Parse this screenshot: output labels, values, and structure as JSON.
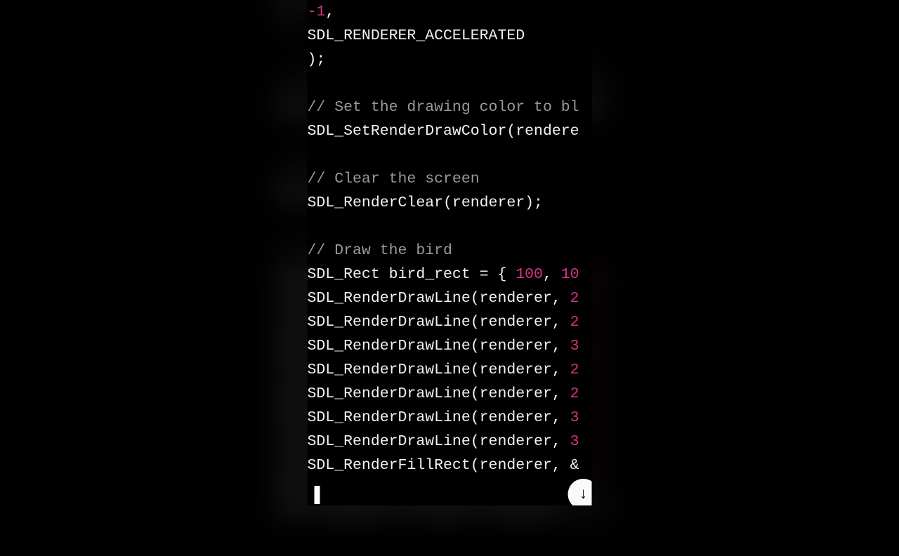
{
  "code": {
    "lines": [
      {
        "indent": "ind1",
        "tokens": [
          {
            "cls": "tok-num",
            "t": "-1"
          },
          {
            "cls": "tok-punct",
            "t": ","
          }
        ]
      },
      {
        "indent": "ind1",
        "tokens": [
          {
            "cls": "tok-ident",
            "t": "SDL_RENDERER_ACCELERATED"
          }
        ]
      },
      {
        "indent": "ind0",
        "tokens": [
          {
            "cls": "tok-punct",
            "t": ");"
          }
        ]
      },
      {
        "indent": "ind0",
        "tokens": []
      },
      {
        "indent": "ind0",
        "tokens": [
          {
            "cls": "tok-comment",
            "t": "// Set the drawing color to bl"
          }
        ]
      },
      {
        "indent": "ind0",
        "tokens": [
          {
            "cls": "tok-ident",
            "t": "SDL_SetRenderDrawColor(rendere"
          }
        ]
      },
      {
        "indent": "ind0",
        "tokens": []
      },
      {
        "indent": "ind0",
        "tokens": [
          {
            "cls": "tok-comment",
            "t": "// Clear the screen"
          }
        ]
      },
      {
        "indent": "ind0",
        "tokens": [
          {
            "cls": "tok-ident",
            "t": "SDL_RenderClear(renderer);"
          }
        ]
      },
      {
        "indent": "ind0",
        "tokens": []
      },
      {
        "indent": "ind0",
        "tokens": [
          {
            "cls": "tok-comment",
            "t": "// Draw the bird"
          }
        ]
      },
      {
        "indent": "ind0",
        "tokens": [
          {
            "cls": "tok-ident",
            "t": "SDL_Rect bird_rect = { "
          },
          {
            "cls": "tok-num",
            "t": "100"
          },
          {
            "cls": "tok-punct",
            "t": ", "
          },
          {
            "cls": "tok-num",
            "t": "10"
          }
        ]
      },
      {
        "indent": "ind0",
        "tokens": [
          {
            "cls": "tok-ident",
            "t": "SDL_RenderDrawLine(renderer, "
          },
          {
            "cls": "tok-num",
            "t": "2"
          }
        ]
      },
      {
        "indent": "ind0",
        "tokens": [
          {
            "cls": "tok-ident",
            "t": "SDL_RenderDrawLine(renderer, "
          },
          {
            "cls": "tok-num",
            "t": "2"
          }
        ]
      },
      {
        "indent": "ind0",
        "tokens": [
          {
            "cls": "tok-ident",
            "t": "SDL_RenderDrawLine(renderer, "
          },
          {
            "cls": "tok-num",
            "t": "3"
          }
        ]
      },
      {
        "indent": "ind0",
        "tokens": [
          {
            "cls": "tok-ident",
            "t": "SDL_RenderDrawLine(renderer, "
          },
          {
            "cls": "tok-num",
            "t": "2"
          }
        ]
      },
      {
        "indent": "ind0",
        "tokens": [
          {
            "cls": "tok-ident",
            "t": "SDL_RenderDrawLine(renderer, "
          },
          {
            "cls": "tok-num",
            "t": "2"
          }
        ]
      },
      {
        "indent": "ind0",
        "tokens": [
          {
            "cls": "tok-ident",
            "t": "SDL_RenderDrawLine(renderer, "
          },
          {
            "cls": "tok-num",
            "t": "3"
          }
        ]
      },
      {
        "indent": "ind0",
        "tokens": [
          {
            "cls": "tok-ident",
            "t": "SDL_RenderDrawLine(renderer, "
          },
          {
            "cls": "tok-num",
            "t": "3"
          }
        ]
      },
      {
        "indent": "ind0",
        "tokens": [
          {
            "cls": "tok-ident",
            "t": "SDL_RenderFillRect(renderer, "
          },
          {
            "cls": "tok-ident",
            "t": "&"
          }
        ]
      }
    ]
  },
  "scroll_btn_glyph": "↓"
}
